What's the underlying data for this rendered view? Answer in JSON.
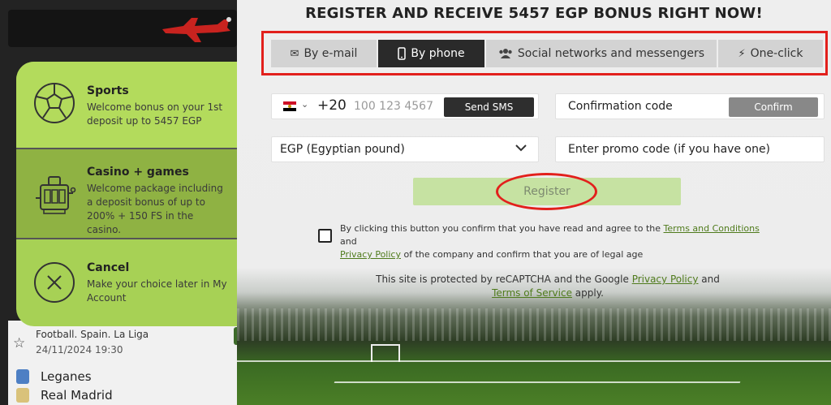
{
  "headline": "REGISTER AND RECEIVE 5457 EGP BONUS RIGHT NOW!",
  "tabs": [
    {
      "label": "By e-mail",
      "icon": "envelope-icon",
      "active": false
    },
    {
      "label": "By phone",
      "icon": "phone-icon",
      "active": true
    },
    {
      "label": "Social networks and messengers",
      "icon": "users-icon",
      "active": false
    },
    {
      "label": "One-click",
      "icon": "lightning-icon",
      "active": false
    }
  ],
  "phone": {
    "country_code": "+20",
    "placeholder": "100 123 4567",
    "send_sms_label": "Send SMS",
    "flag": "egypt-flag"
  },
  "confirmation": {
    "label": "Confirmation code",
    "button_label": "Confirm"
  },
  "currency": {
    "selected": "EGP (Egyptian pound)"
  },
  "promo": {
    "label": "Enter promo code (if you have one)"
  },
  "register_label": "Register",
  "terms": {
    "prefix": "By clicking this button you confirm that you have read and agree to the",
    "terms_link": "Terms and Conditions",
    "and": "and",
    "privacy_link": "Privacy Policy",
    "suffix": "of the company and confirm that you are of legal age"
  },
  "captcha": {
    "prefix": "This site is protected by reCAPTCHA and the Google",
    "privacy_link": "Privacy Policy",
    "and": "and",
    "terms_link": "Terms of Service",
    "suffix": "apply."
  },
  "bonus_options": [
    {
      "title": "Sports",
      "description": "Welcome bonus on your 1st deposit up to 5457 EGP",
      "icon": "soccer-ball-icon"
    },
    {
      "title": "Casino + games",
      "description": "Welcome package including a deposit bonus of up to 200% + 150 FS in the casino.",
      "icon": "slot-machine-icon"
    },
    {
      "title": "Cancel",
      "description": "Make your choice later in My Account",
      "icon": "close-circle-icon"
    }
  ],
  "match": {
    "league": "Football. Spain. La Liga",
    "datetime": "24/11/2024 19:30",
    "team1": "Leganes",
    "team2": "Real Madrid"
  },
  "colors": {
    "accent_green": "#a7d155",
    "highlight_red": "#e2201c",
    "dark": "#2a2a2a"
  }
}
